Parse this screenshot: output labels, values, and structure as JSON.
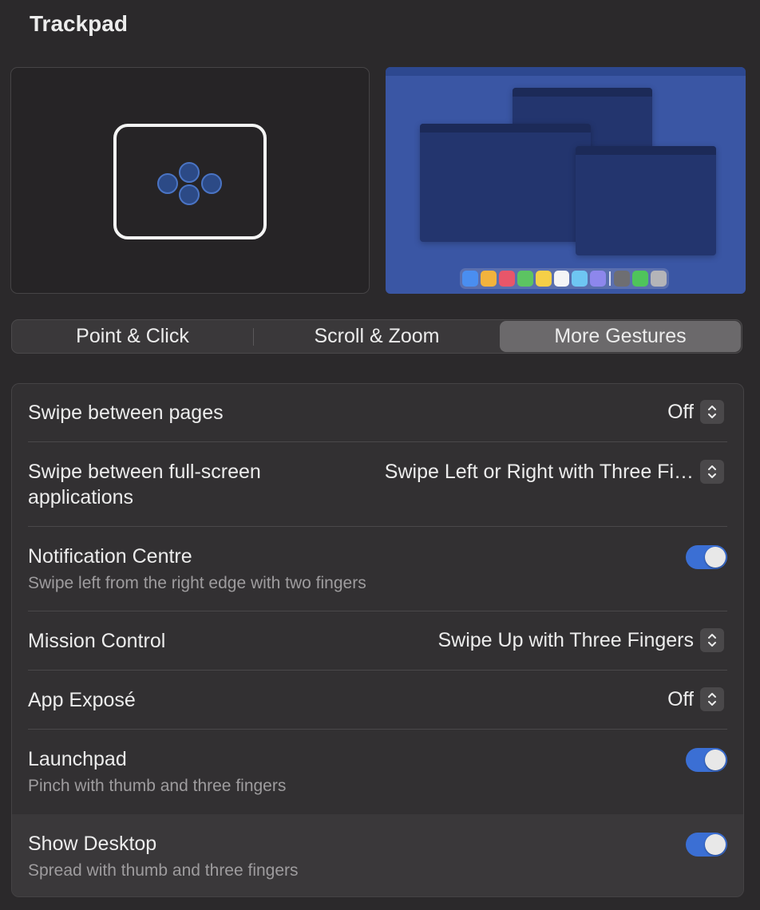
{
  "window": {
    "title": "Trackpad"
  },
  "tabs": [
    {
      "label": "Point & Click",
      "active": false
    },
    {
      "label": "Scroll & Zoom",
      "active": false
    },
    {
      "label": "More Gestures",
      "active": true
    }
  ],
  "settings": {
    "swipe_pages": {
      "label": "Swipe between pages",
      "value": "Off"
    },
    "swipe_fullscreen": {
      "label_line1": "Swipe between full-screen",
      "label_line2": "applications",
      "value": "Swipe Left or Right with Three Fi…"
    },
    "notification_centre": {
      "label": "Notification Centre",
      "description": "Swipe left from the right edge with two fingers",
      "enabled": true
    },
    "mission_control": {
      "label": "Mission Control",
      "value": "Swipe Up with Three Fingers"
    },
    "app_expose": {
      "label": "App Exposé",
      "value": "Off"
    },
    "launchpad": {
      "label": "Launchpad",
      "description": "Pinch with thumb and three fingers",
      "enabled": true
    },
    "show_desktop": {
      "label": "Show Desktop",
      "description": "Spread with thumb and three fingers",
      "enabled": true
    }
  },
  "colors": {
    "accent": "#3b6fd4",
    "background": "#2b292b",
    "group_background": "#323032",
    "desktop_preview": "#3a56a4"
  },
  "icons": {
    "popup": "up-down-chevron-icon",
    "trackpad": "trackpad-icon",
    "fingers": "finger-dot-icon"
  }
}
